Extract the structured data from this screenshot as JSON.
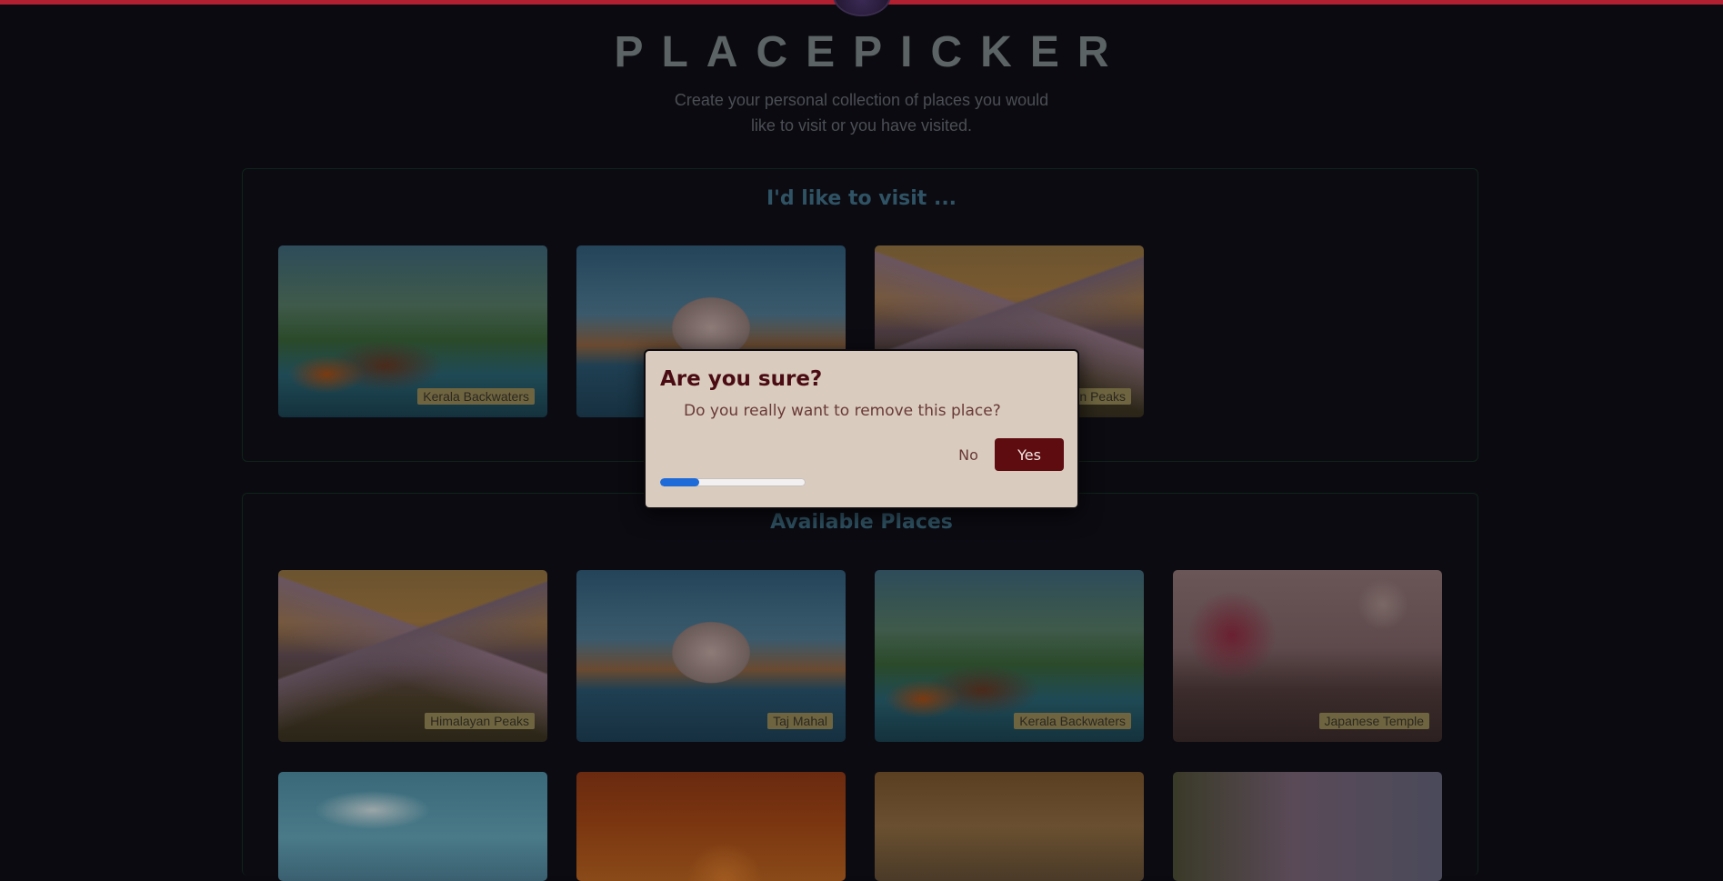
{
  "header": {
    "title": "PLACEPICKER",
    "tagline": "Create your personal collection of places you would like to visit or you have visited."
  },
  "sections": {
    "picked": {
      "title": "I'd like to visit ...",
      "places": [
        {
          "label": "Kerala Backwaters",
          "scene": "kerala"
        },
        {
          "label": "",
          "scene": "taj"
        },
        {
          "label": "n Peaks",
          "scene": "himalaya"
        }
      ]
    },
    "available": {
      "title": "Available Places",
      "places": [
        {
          "label": "Himalayan Peaks",
          "scene": "himalaya"
        },
        {
          "label": "Taj Mahal",
          "scene": "taj"
        },
        {
          "label": "Kerala Backwaters",
          "scene": "kerala"
        },
        {
          "label": "Japanese Temple",
          "scene": "japan"
        },
        {
          "label": "",
          "scene": "coast"
        },
        {
          "label": "",
          "scene": "sunset"
        },
        {
          "label": "",
          "scene": "venice"
        },
        {
          "label": "",
          "scene": "street"
        }
      ]
    }
  },
  "modal": {
    "title": "Are you sure?",
    "message": "Do you really want to remove this place?",
    "no_label": "No",
    "yes_label": "Yes",
    "progress_fraction": 0.27
  },
  "colors": {
    "accent_bar": "#b02030",
    "modal_bg": "#d9cbbe",
    "yes_button": "#5e0c10",
    "progress": "#1d6ad8"
  }
}
